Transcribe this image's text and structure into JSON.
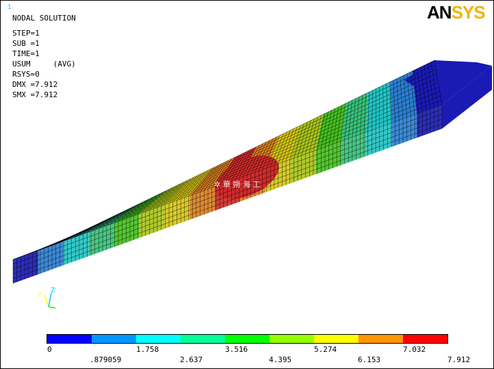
{
  "window_number": "1",
  "logo": {
    "left": "AN",
    "right": "SYS"
  },
  "info_lines": [
    "NODAL SOLUTION",
    "",
    "STEP=1",
    "SUB =1",
    "TIME=1",
    "USUM     (AVG)",
    "RSYS=0",
    "DMX =7.912",
    "SMX =7.912"
  ],
  "watermark": "✲ 華 朔 海 工",
  "triad": {
    "y": "Y",
    "z": "Z"
  },
  "legend": {
    "colors": [
      "#0000ff",
      "#0096ff",
      "#00ffff",
      "#00ff96",
      "#00ff00",
      "#96ff00",
      "#ffff00",
      "#ff9600",
      "#ff0000"
    ],
    "labels_top": [
      "0",
      "1.758",
      "3.516",
      "5.274",
      "7.032"
    ],
    "labels_bottom": [
      ".879059",
      "2.637",
      "4.395",
      "6.153",
      "7.912"
    ]
  },
  "mesh_colors": [
    "#1a1ab4",
    "#2a7fd0",
    "#22c4c4",
    "#38c07a",
    "#46bf20",
    "#a9c51a",
    "#d4c517",
    "#d8801f",
    "#d02a2a"
  ]
}
